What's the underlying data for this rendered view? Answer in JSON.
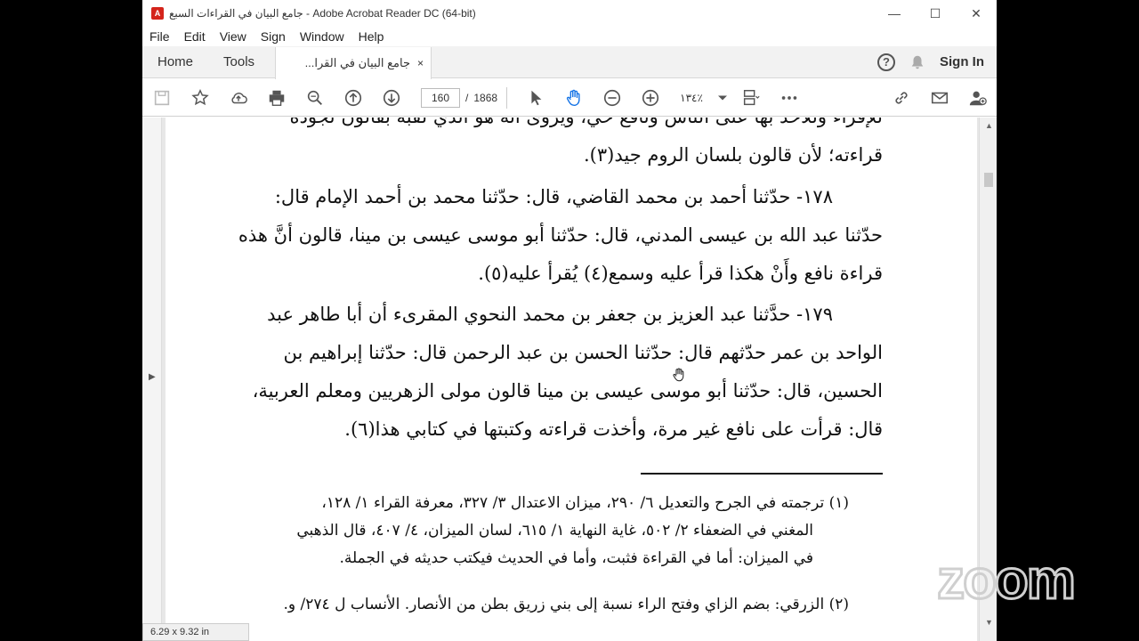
{
  "window": {
    "title": "جامع البيان في القراءات السبع - Adobe Acrobat Reader DC (64-bit)",
    "app_icon": "acrobat-icon"
  },
  "menu": [
    "File",
    "Edit",
    "View",
    "Sign",
    "Window",
    "Help"
  ],
  "tabs": {
    "home": "Home",
    "tools": "Tools",
    "document": "جامع البيان في القرا...",
    "close_glyph": "×",
    "help_glyph": "?",
    "sign_in": "Sign In"
  },
  "toolbar": {
    "current_page": "160",
    "separator": "/",
    "total_pages": "1868",
    "zoom": "١٣٤٪"
  },
  "document": {
    "paragraphs": [
      {
        "lines": [
          "للإقراء وللاحد بها على الناس ونافع حي، ويروى أنه هو الذي لقبه بقالون لجودة",
          "قراءته؛ لأن قالون بلسان الروم جيد(٣)."
        ]
      },
      {
        "lines": [
          "١٧٨- حدّثنا أحمد بن محمد القاضي، قال: حدّثنا محمد بن أحمد الإمام قال:",
          "حدّثنا عبد الله بن عيسى المدني، قال: حدّثنا أبو موسى عيسى بن مينا، قالون أنَّ هذه",
          "قراءة نافع وأَنْ هكذا قرأ عليه وسمع(٤) يُقرأ عليه(٥)."
        ]
      },
      {
        "lines": [
          "١٧٩- حدَّثنا عبد العزيز بن جعفر بن محمد النحوي المقرىء أن أبا طاهر عبد",
          "الواحد بن عمر حدّثهم قال: حدّثنا الحسن بن عبد الرحمن قال: حدّثنا إبراهيم بن",
          "الحسين، قال: حدّثنا أبو موسى عيسى بن مينا قالون مولى الزهريين ومعلم العربية،",
          "قال: قرأت على نافع غير مرة، وأخذت قراءته وكتبتها في كتابي هذا(٦)."
        ]
      }
    ],
    "footnotes": [
      {
        "lines": [
          "(١) ترجمته في الجرح والتعديل ٦/ ٢٩٠، ميزان الاعتدال ٣/ ٣٢٧، معرفة القراء ١/ ١٢٨،",
          "المغني في الضعفاء ٢/ ٥٠٢، غاية النهاية ١/ ٦١٥، لسان الميزان، ٤/ ٤٠٧، قال الذهبي",
          "في الميزان: أما في القراءة فثبت، وأما في الحديث فيكتب حديثه في الجملة."
        ]
      },
      {
        "lines": [
          "(٢) الزرقي: بضم الزاي وفتح الراء نسبة إلى بني زريق بطن من الأنصار. الأنساب ل ٢٧٤/ و."
        ]
      }
    ]
  },
  "status": {
    "page_size": "6.29 x 9.32 in"
  },
  "watermark": {
    "text": "zoom"
  },
  "colors": {
    "acrobat_red": "#d4241b",
    "text": "#111111",
    "doc_background": "#e7e7e7"
  }
}
